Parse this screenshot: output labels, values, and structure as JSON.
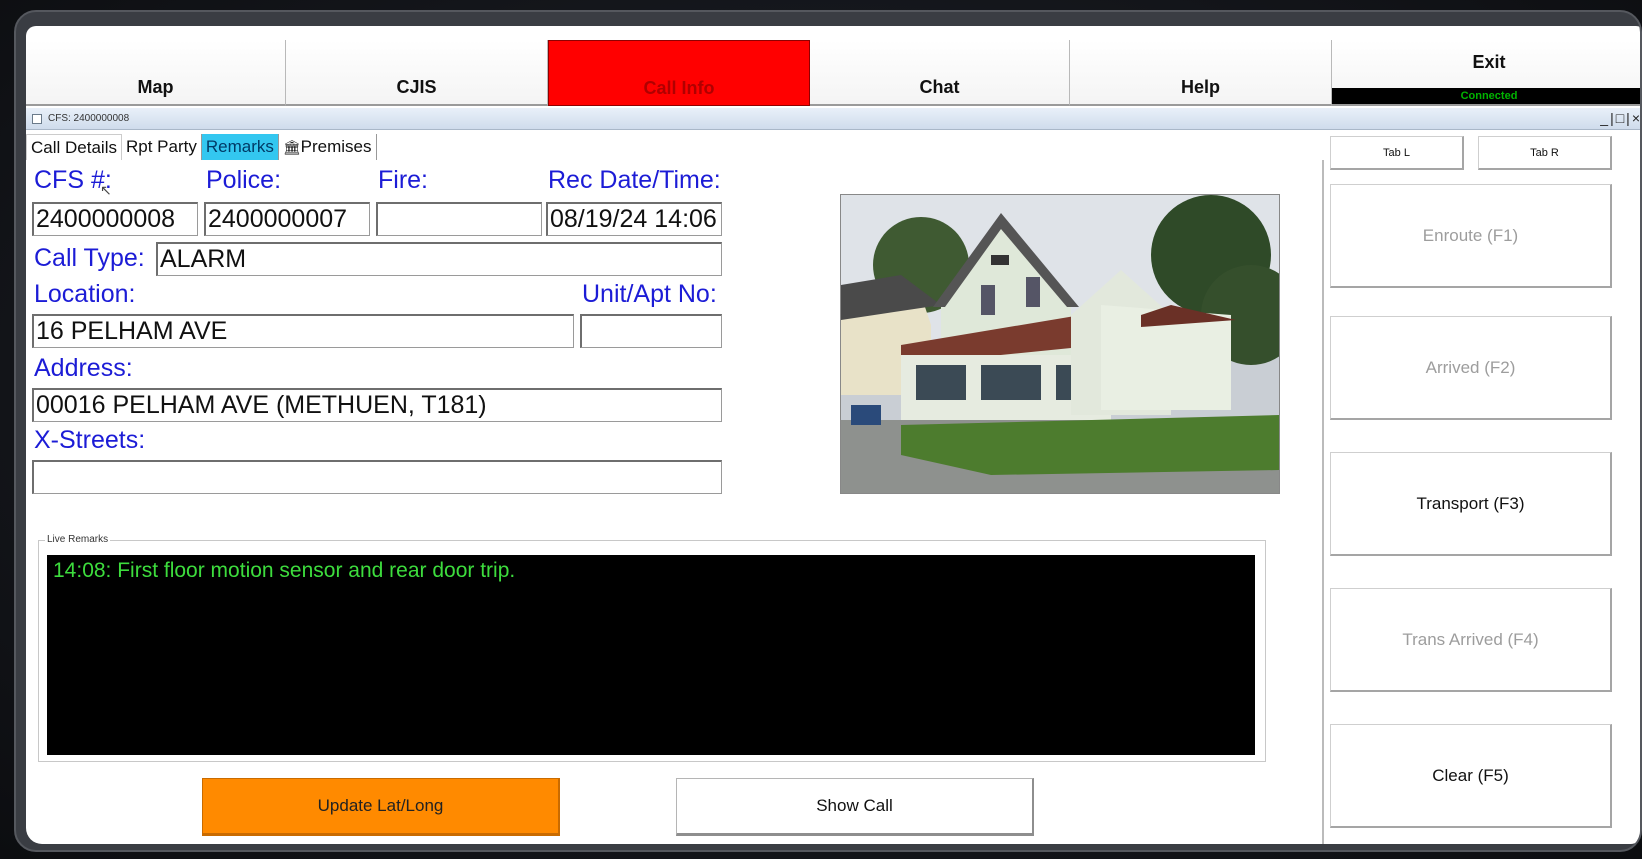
{
  "nav": {
    "items": [
      {
        "label": "Map"
      },
      {
        "label": "CJIS"
      },
      {
        "label": "Call Info"
      },
      {
        "label": "Chat"
      },
      {
        "label": "Help"
      }
    ],
    "exit_label": "Exit",
    "status": "Connected"
  },
  "window": {
    "title": "CFS: 2400000008",
    "controls": "_|□|×"
  },
  "tabs": [
    {
      "label": "Call Details"
    },
    {
      "label": "Rpt Party"
    },
    {
      "label": "Remarks"
    },
    {
      "label": "Premises"
    }
  ],
  "premises_icon": "🏛",
  "form": {
    "cfs_label": "CFS #:",
    "police_label": "Police:",
    "fire_label": "Fire:",
    "rec_label": "Rec Date/Time:",
    "cfs_value": "2400000008",
    "police_value": "2400000007",
    "fire_value": "",
    "rec_value": "08/19/24 14:06",
    "call_type_label": "Call Type:",
    "call_type_value": "ALARM",
    "location_label": "Location:",
    "unit_label": "Unit/Apt No:",
    "location_value": "16 PELHAM AVE",
    "unit_value": "",
    "address_label": "Address:",
    "address_value": "00016 PELHAM AVE (METHUEN, T181)",
    "xstreets_label": "X-Streets:",
    "xstreets_value": ""
  },
  "remarks": {
    "title": "Live Remarks",
    "text": "14:08: First floor motion sensor and rear door trip."
  },
  "buttons": {
    "update": "Update Lat/Long",
    "show_call": "Show Call"
  },
  "side": {
    "tab_l": "Tab L",
    "tab_r": "Tab R",
    "enroute": "Enroute (F1)",
    "arrived": "Arrived (F2)",
    "transport": "Transport (F3)",
    "trans_arrived": "Trans Arrived (F4)",
    "clear": "Clear (F5)"
  },
  "colors": {
    "active_tab": "#ff0000",
    "remarks_tab": "#33c7f0",
    "label_blue": "#1c1cd6",
    "remarks_green": "#3ddc3d",
    "update_button": "#ff8a00"
  }
}
